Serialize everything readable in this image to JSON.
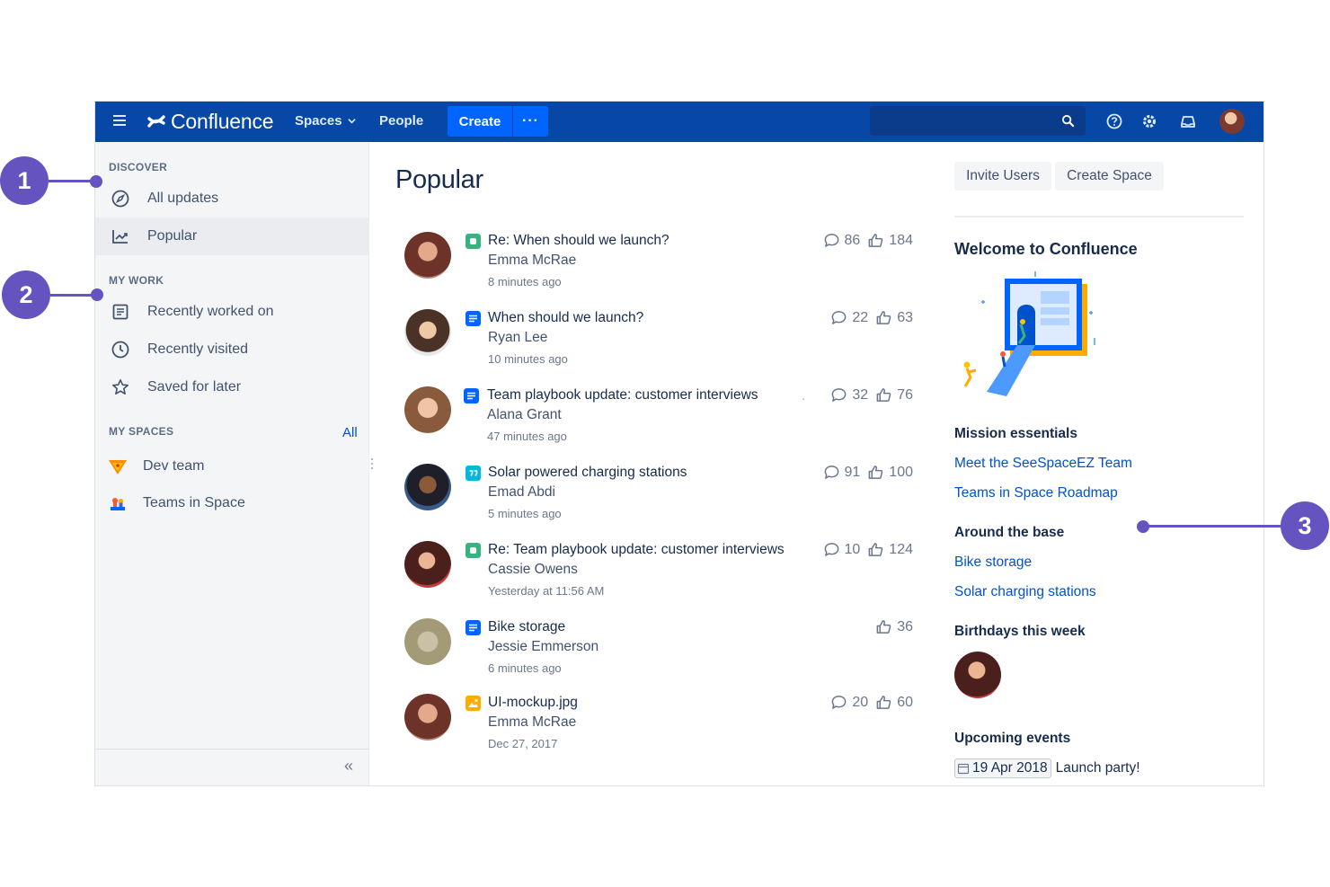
{
  "nav": {
    "app_name": "Confluence",
    "spaces": "Spaces",
    "people": "People",
    "create": "Create",
    "more": "···",
    "search_placeholder": ""
  },
  "sidebar": {
    "discover_heading": "DISCOVER",
    "discover": [
      {
        "label": "All updates",
        "icon": "compass-icon",
        "active": false
      },
      {
        "label": "Popular",
        "icon": "trending-icon",
        "active": true
      }
    ],
    "mywork_heading": "MY WORK",
    "mywork": [
      {
        "label": "Recently worked on",
        "icon": "document-list-icon"
      },
      {
        "label": "Recently visited",
        "icon": "clock-icon"
      },
      {
        "label": "Saved for later",
        "icon": "star-icon"
      }
    ],
    "myspaces_heading": "MY SPACES",
    "all_link": "All",
    "spaces": [
      {
        "label": "Dev team",
        "icon": "dev-team-space-icon"
      },
      {
        "label": "Teams in Space",
        "icon": "teams-in-space-icon"
      }
    ],
    "collapse": "«"
  },
  "main": {
    "title": "Popular",
    "feed": [
      {
        "title": "Re: When should we launch?",
        "author": "Emma McRae",
        "time": "8 minutes ago",
        "type": "comment",
        "comments": "86",
        "likes": "184"
      },
      {
        "title": "When should we launch?",
        "author": "Ryan Lee",
        "time": "10 minutes ago",
        "type": "page",
        "comments": "22",
        "likes": "63"
      },
      {
        "title": "Team playbook update: customer interviews",
        "author": "Alana Grant",
        "time": "47 minutes ago",
        "type": "page",
        "comments": "32",
        "likes": "76"
      },
      {
        "title": "Solar powered charging stations",
        "author": "Emad Abdi",
        "time": "5 minutes ago",
        "type": "quote",
        "comments": "91",
        "likes": "100"
      },
      {
        "title": "Re: Team playbook update: customer interviews",
        "author": "Cassie Owens",
        "time": "Yesterday at 11:56 AM",
        "type": "comment",
        "comments": "10",
        "likes": "124"
      },
      {
        "title": "Bike storage",
        "author": "Jessie Emmerson",
        "time": "6 minutes ago",
        "type": "page",
        "comments": "",
        "likes": "36"
      },
      {
        "title": "UI-mockup.jpg",
        "author": "Emma McRae",
        "time": "Dec 27, 2017",
        "type": "image",
        "comments": "20",
        "likes": "60"
      }
    ],
    "separator": "."
  },
  "right": {
    "invite_users": "Invite Users",
    "create_space": "Create Space",
    "welcome": "Welcome to Confluence",
    "mission_heading": "Mission essentials",
    "mission_links": [
      "Meet the SeeSpaceEZ Team",
      "Teams in Space Roadmap"
    ],
    "around_heading": "Around the base",
    "around_links": [
      "Bike storage",
      "Solar charging stations"
    ],
    "birthdays_heading": "Birthdays this week",
    "events_heading": "Upcoming events",
    "event_date": "19 Apr 2018",
    "event_name": "Launch party!"
  },
  "callouts": {
    "one": "1",
    "two": "2",
    "three": "3"
  },
  "colors": {
    "nav_bg": "#0747a6",
    "accent": "#0065ff",
    "link": "#0052cc",
    "callout": "#6554c0",
    "comment_icon": "#36b37e",
    "page_icon": "#0065ff",
    "quote_icon": "#00b8d9",
    "image_icon": "#ffab00"
  }
}
